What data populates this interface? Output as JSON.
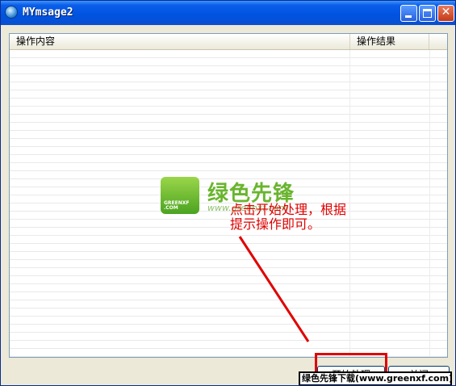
{
  "window": {
    "title": "MYmsage2",
    "controls": {
      "minimize": "minimize",
      "maximize": "maximize",
      "close": "✕"
    }
  },
  "table": {
    "columns": [
      "操作内容",
      "操作结果"
    ],
    "rows": []
  },
  "watermark": {
    "logo_text": "GREENXF .COM",
    "brand": "绿色先锋",
    "url": "www.greenxf.com"
  },
  "annotation": {
    "line1": "点击开始处理，根据",
    "line2": "提示操作即可。"
  },
  "buttons": {
    "start": "开始处理",
    "close": "关闭"
  },
  "banner": {
    "text": "绿色先锋下载(www.greenxf.com)"
  },
  "colors": {
    "titlebar": "#0053e0",
    "annotation_red": "#e00000",
    "brand_green": "#69b52e"
  }
}
